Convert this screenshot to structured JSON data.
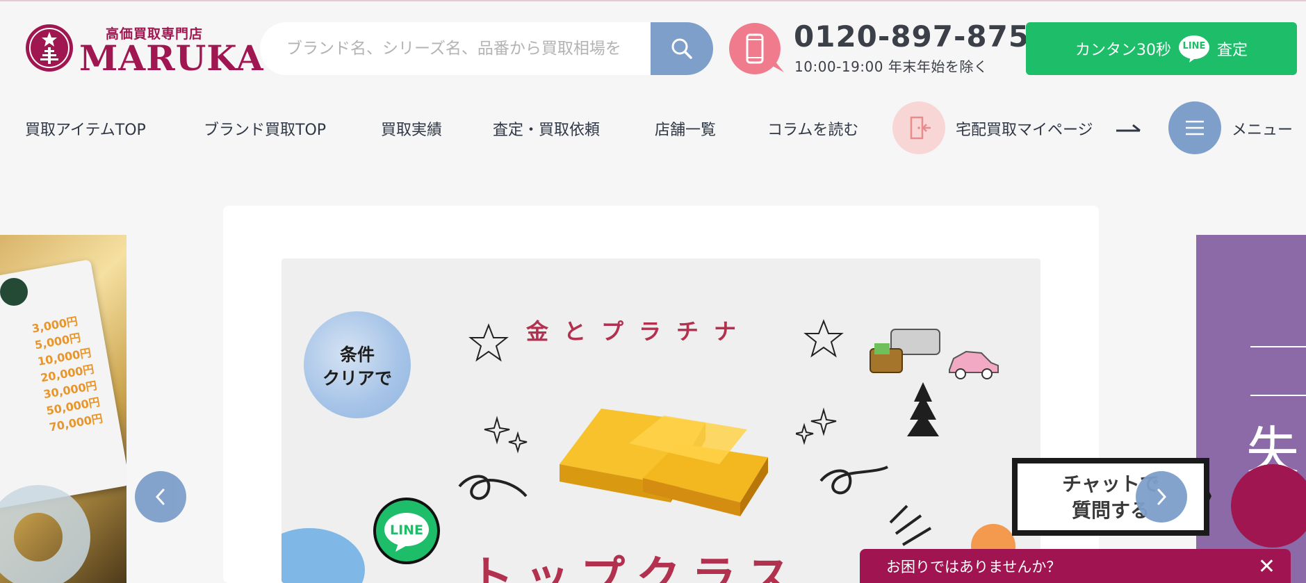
{
  "header": {
    "logo_sub": "高価買取専門店",
    "logo_main": "MARUKA",
    "search_placeholder": "ブランド名、シリーズ名、品番から買取相場を",
    "phone_number": "0120-897-875",
    "phone_hours": "10:00-19:00  年末年始を除く",
    "line_button": {
      "prefix": "カンタン30秒",
      "badge": "LINE",
      "suffix": "査定"
    }
  },
  "nav": {
    "items": [
      "買取アイテムTOP",
      "ブランド買取TOP",
      "買取実績",
      "査定・買取依頼",
      "店舗一覧",
      "コラムを読む"
    ],
    "mypage_label": "宅配買取マイページ",
    "menu_label": "メニュー"
  },
  "carousel": {
    "left_slide_prices": [
      "3,000円",
      "5,000円",
      "10,000円",
      "20,000円",
      "30,000円",
      "50,000円",
      "70,000円"
    ],
    "banner": {
      "condition_line1": "条件",
      "condition_line2": "クリアで",
      "heading": "金とプラチナ",
      "line_badge": "LINE",
      "bottom_text": "トップクラス"
    },
    "right_slide_char": "失"
  },
  "chat": {
    "line1": "チャットで",
    "line2": "質問する"
  },
  "help": {
    "text": "お困りではありませんか？",
    "close": "✕"
  },
  "colors": {
    "brand": "#a01650",
    "search_button": "#7e9fca",
    "line_green": "#1dbd6a",
    "phone_pink": "#f07b8c",
    "help_bar": "#a11452"
  }
}
